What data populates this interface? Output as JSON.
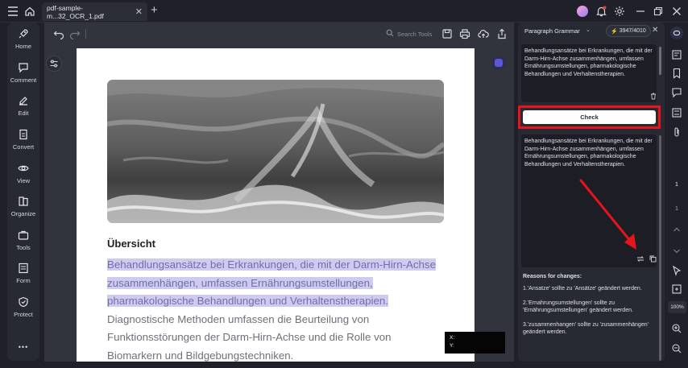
{
  "titlebar": {
    "tab_title": "pdf-sample-m...32_OCR_1.pdf",
    "tab_close": "✕",
    "new_tab": "+"
  },
  "leftnav": {
    "items": [
      {
        "label": "Home",
        "icon": "rocket-icon"
      },
      {
        "label": "Comment",
        "icon": "comment-icon"
      },
      {
        "label": "Edit",
        "icon": "edit-icon"
      },
      {
        "label": "Convert",
        "icon": "convert-icon"
      },
      {
        "label": "View",
        "icon": "eye-icon"
      },
      {
        "label": "Organize",
        "icon": "organize-icon"
      },
      {
        "label": "Tools",
        "icon": "toolbox-icon"
      },
      {
        "label": "Form",
        "icon": "form-icon"
      },
      {
        "label": "Protect",
        "icon": "shield-icon"
      }
    ],
    "more": "•••"
  },
  "toolbar": {
    "search_placeholder": "Search Tools"
  },
  "document": {
    "heading": "Übersicht",
    "highlighted_lines": [
      "Behandlungsansätze bei Erkrankungen, die mit der Darm-Hirn-Achse",
      "zusammenhängen, umfassen Ernährungsumstellungen,",
      "pharmakologische Behandlungen und Verhaltenstherapien."
    ],
    "normal_lines": [
      "Diagnostische Methoden umfassen die Beurteilung von",
      "Funktionsstörungen der Darm-Hirn-Achse und die Rolle von",
      "Biomarkern und Bildgebungstechniken."
    ]
  },
  "coords": {
    "x_label": "X:",
    "y_label": "Y:"
  },
  "panel": {
    "title": "Paragraph Grammar",
    "credits": "3947/4010",
    "close": "✕",
    "input_text": "Behandlungsansätze bei Erkrankungen, die mit der Darm-Hirn-Achse zusammenhängen, umfassen Ernährungsumstellungen, pharmakologische Behandlungen und Verhaltenstherapien.",
    "check_label": "Check",
    "output_text": "Behandlungsansätze bei Erkrankungen, die mit der Darm-Hirn-Achse zusammenhängen, umfassen Ernährungsumstellungen, pharmakologische Behandlungen und Verhaltenstherapien.",
    "reasons_title": "Reasons for changes:",
    "reasons": [
      "1.'Ansatze' sollte zu 'Ansätze' geändert werden.",
      "2.'Ernahrungsumstellungen' sollte zu 'Ernährungsumstellungen' geändert werden.",
      "3.'zusammenhangen' sollte zu 'zusammenhängen' geändert werden."
    ]
  },
  "rightbar": {
    "page_current": "1",
    "page_total": "1",
    "zoom": "100%"
  },
  "colors": {
    "highlight": "#cfcbf0",
    "annotation_red": "#e5141d",
    "accent_purple": "#5b57d6"
  }
}
